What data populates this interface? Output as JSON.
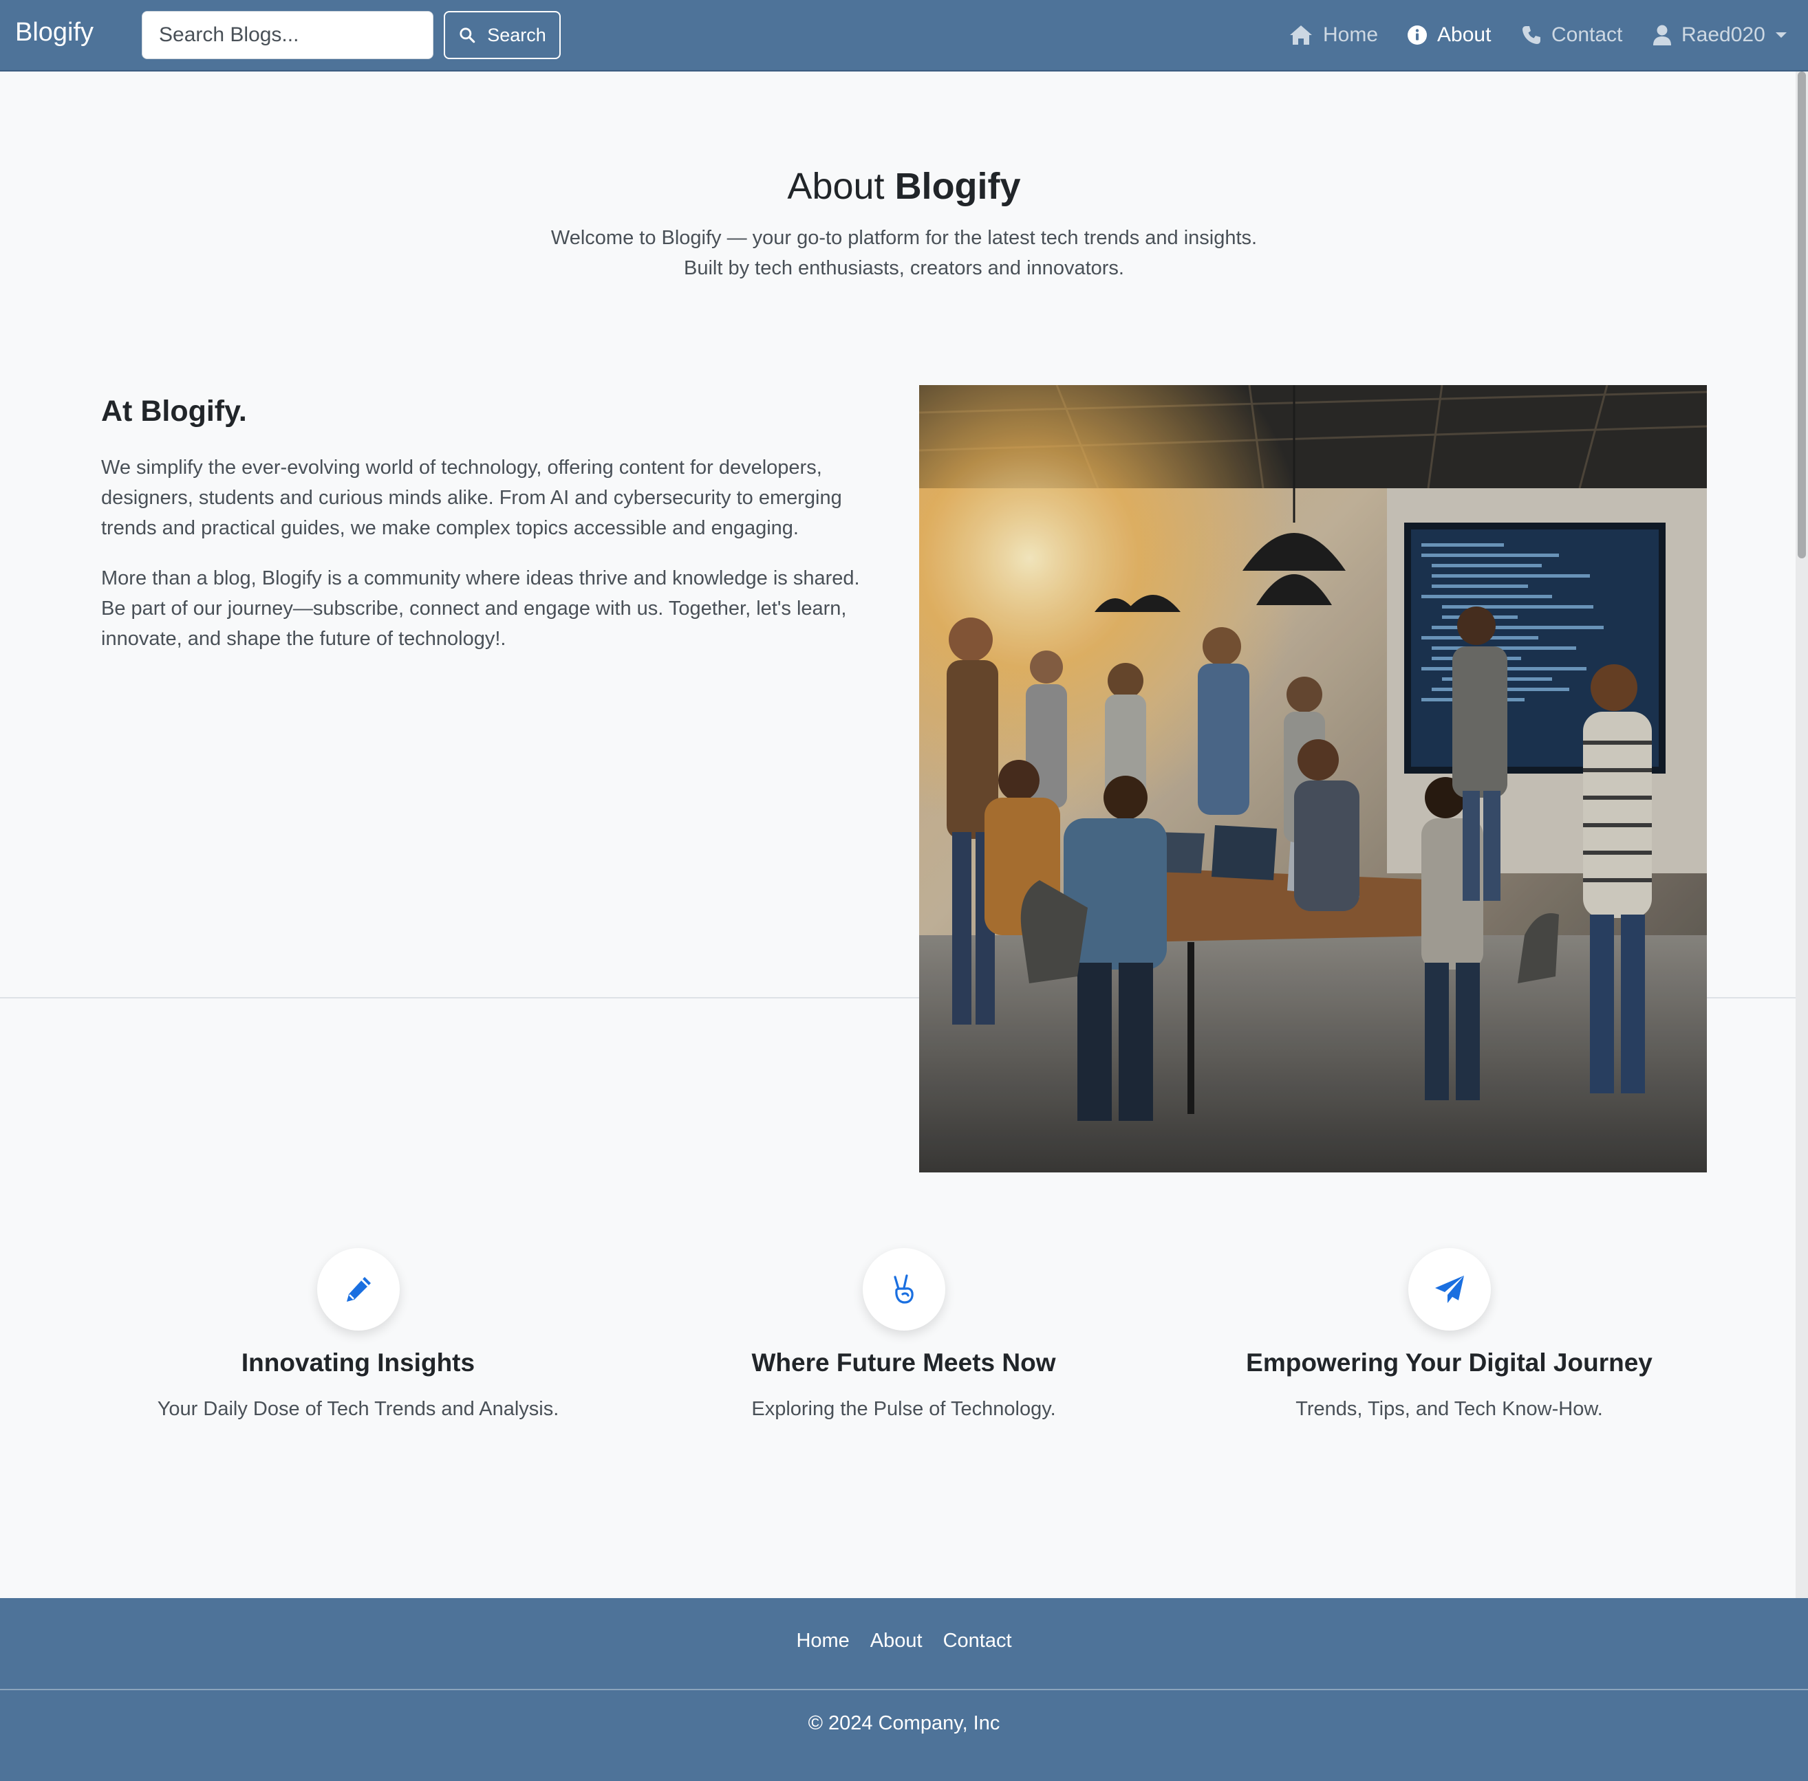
{
  "navbar": {
    "brand": "Blogify",
    "search": {
      "placeholder": "Search Blogs...",
      "button_label": "Search"
    },
    "links": [
      {
        "label": "Home",
        "icon": "home-icon",
        "active": false
      },
      {
        "label": "About",
        "icon": "info-icon",
        "active": true
      },
      {
        "label": "Contact",
        "icon": "phone-icon",
        "active": false
      }
    ],
    "user": {
      "label": "Raed020",
      "icon": "user-icon"
    }
  },
  "hero": {
    "title_prefix": "About",
    "title_brand": "Blogify",
    "subtitle_lines": [
      "Welcome to Blogify — your go-to platform for the latest tech trends and insights.",
      "Built by tech enthusiasts, creators and innovators."
    ]
  },
  "about": {
    "heading": "At Blogify.",
    "paragraphs": [
      "We simplify the ever-evolving world of technology, offering content for developers, designers, students and curious minds alike. From AI and cybersecurity to emerging trends and practical guides, we make complex topics accessible and engaging.",
      "More than a blog, Blogify is a community where ideas thrive and knowledge is shared. Be part of our journey—subscribe, connect and engage with us. Together, let's learn, innovate, and shape the future of technology!."
    ]
  },
  "features": [
    {
      "icon": "pencil-icon",
      "title": "Innovating Insights",
      "text": "Your Daily Dose of Tech Trends and Analysis."
    },
    {
      "icon": "peace-hand-icon",
      "title": "Where Future Meets Now",
      "text": "Exploring the Pulse of Technology."
    },
    {
      "icon": "paper-plane-icon",
      "title": "Empowering Your Digital Journey",
      "text": "Trends, Tips, and Tech Know-How."
    }
  ],
  "footer": {
    "links": [
      "Home",
      "About",
      "Contact"
    ],
    "copyright": "© 2024 Company, Inc"
  },
  "colors": {
    "navbar_bg": "#4e7399",
    "page_bg": "#f8f9fa",
    "accent_blue": "#1a6fe0",
    "text_dark": "#212529",
    "text_muted": "#495057"
  }
}
